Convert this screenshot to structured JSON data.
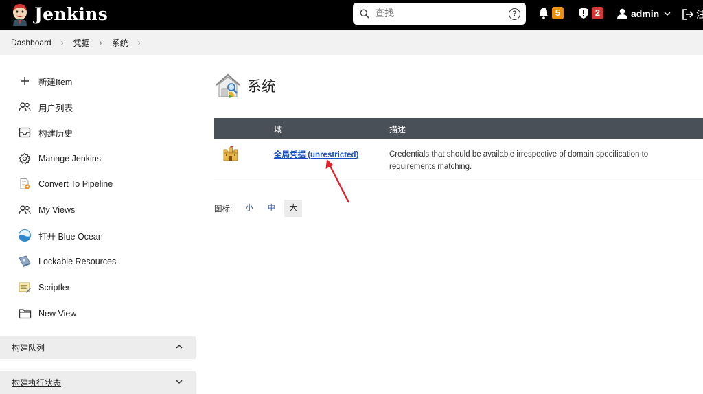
{
  "header": {
    "brand": "Jenkins",
    "search_placeholder": "查找",
    "help_glyph": "?",
    "notifications_count": "5",
    "security_count": "2",
    "user": "admin",
    "logout_label": "注"
  },
  "breadcrumb": [
    "Dashboard",
    "凭据",
    "系统"
  ],
  "sidebar": {
    "items": [
      {
        "label": "新建Item",
        "icon": "plus-icon"
      },
      {
        "label": "用户列表",
        "icon": "people-icon"
      },
      {
        "label": "构建历史",
        "icon": "history-icon"
      },
      {
        "label": "Manage Jenkins",
        "icon": "gear-icon"
      },
      {
        "label": "Convert To Pipeline",
        "icon": "pipeline-icon"
      },
      {
        "label": "My Views",
        "icon": "people-icon"
      },
      {
        "label": "打开 Blue Ocean",
        "icon": "blue-ocean-icon"
      },
      {
        "label": "Lockable Resources",
        "icon": "lock-resource-icon"
      },
      {
        "label": "Scriptler",
        "icon": "scriptler-icon"
      },
      {
        "label": "New View",
        "icon": "folder-icon"
      }
    ],
    "panels": [
      {
        "label": "构建队列",
        "state": "expanded"
      },
      {
        "label": "构建执行状态",
        "state": "collapsed"
      }
    ]
  },
  "main": {
    "title": "系统",
    "table": {
      "headers": [
        "",
        "域",
        "描述"
      ],
      "rows": [
        {
          "domain": "全局凭据 (unrestricted)",
          "description": "Credentials that should be available irrespective of domain specification to requirements matching."
        }
      ]
    },
    "icon_size": {
      "label": "图标:",
      "options": [
        "小",
        "中",
        "大"
      ],
      "selected": "大"
    }
  },
  "colors": {
    "header_bg": "#000000",
    "table_header_bg": "#4a5057",
    "link": "#1a4fc4",
    "annotation_arrow": "#e0202a"
  }
}
